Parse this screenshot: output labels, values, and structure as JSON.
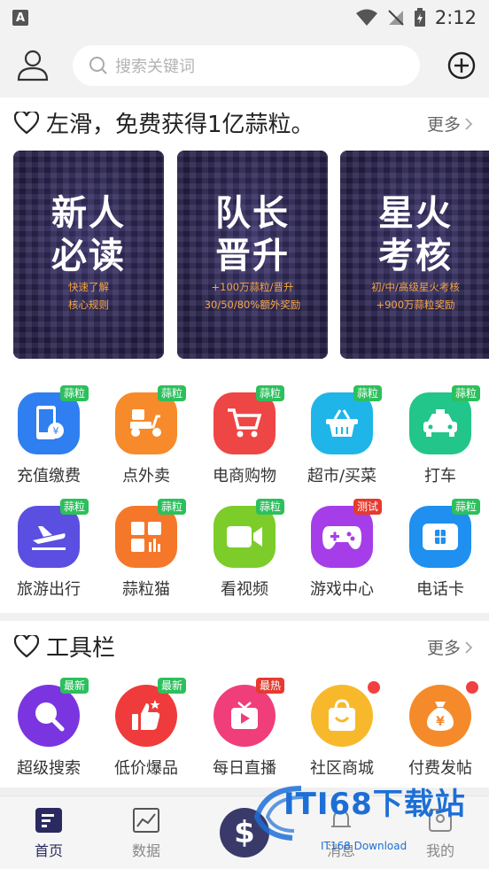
{
  "status_bar": {
    "time": "2:12"
  },
  "header": {
    "search_placeholder": "搜索关键词"
  },
  "promo": {
    "title": "左滑，免费获得1亿蒜粒。",
    "more": "更多",
    "banners": [
      {
        "line1": "新人",
        "line2": "必读",
        "sub1": "快速了解",
        "sub2": "核心规则"
      },
      {
        "line1": "队长",
        "line2": "晋升",
        "sub1": "+100万蒜粒/晋升",
        "sub2": "30/50/80%额外奖励"
      },
      {
        "line1": "星火",
        "line2": "考核",
        "sub1": "初/中/高级星火考核",
        "sub2": "+900万蒜粒奖励"
      }
    ]
  },
  "services": [
    {
      "label": "充值缴费",
      "tag": "蒜粒",
      "color": "#2f7ff0",
      "icon": "phone-recharge-icon"
    },
    {
      "label": "点外卖",
      "tag": "蒜粒",
      "color": "#f78a2a",
      "icon": "scooter-icon"
    },
    {
      "label": "电商购物",
      "tag": "蒜粒",
      "color": "#ee4545",
      "icon": "cart-icon"
    },
    {
      "label": "超市/买菜",
      "tag": "蒜粒",
      "color": "#1fb5e8",
      "icon": "basket-icon"
    },
    {
      "label": "打车",
      "tag": "蒜粒",
      "color": "#22c58a",
      "icon": "taxi-icon"
    },
    {
      "label": "旅游出行",
      "tag": "蒜粒",
      "color": "#5a4fe0",
      "icon": "plane-icon"
    },
    {
      "label": "蒜粒猫",
      "tag": "蒜粒",
      "color": "#f5772a",
      "icon": "grid-app-icon"
    },
    {
      "label": "看视频",
      "tag": "蒜粒",
      "color": "#7ccc2a",
      "icon": "video-camera-icon"
    },
    {
      "label": "游戏中心",
      "tag": "测试",
      "color": "#a53ee8",
      "icon": "gamepad-icon"
    },
    {
      "label": "电话卡",
      "tag": "蒜粒",
      "color": "#1f8ff0",
      "icon": "sim-card-icon"
    }
  ],
  "tools": {
    "title": "工具栏",
    "more": "更多",
    "items": [
      {
        "label": "超级搜索",
        "tag": "最新",
        "color": "#7a35e0",
        "icon": "search-icon"
      },
      {
        "label": "低价爆品",
        "tag": "最新",
        "color": "#ef3b3b",
        "icon": "thumbs-up-icon"
      },
      {
        "label": "每日直播",
        "tag": "最热",
        "color": "#f03e7a",
        "icon": "tv-play-icon"
      },
      {
        "label": "社区商城",
        "tag": "",
        "color": "#f7b92b",
        "icon": "shopping-bag-icon"
      },
      {
        "label": "付费发帖",
        "tag": "",
        "color": "#f58a2a",
        "icon": "money-bag-icon"
      }
    ]
  },
  "nav": {
    "home": "首页",
    "data": "数据",
    "center": "$",
    "message": "消息",
    "mine": "我的"
  },
  "watermark": {
    "line1": "ITI68下载站",
    "line2": "IT168 Download"
  }
}
